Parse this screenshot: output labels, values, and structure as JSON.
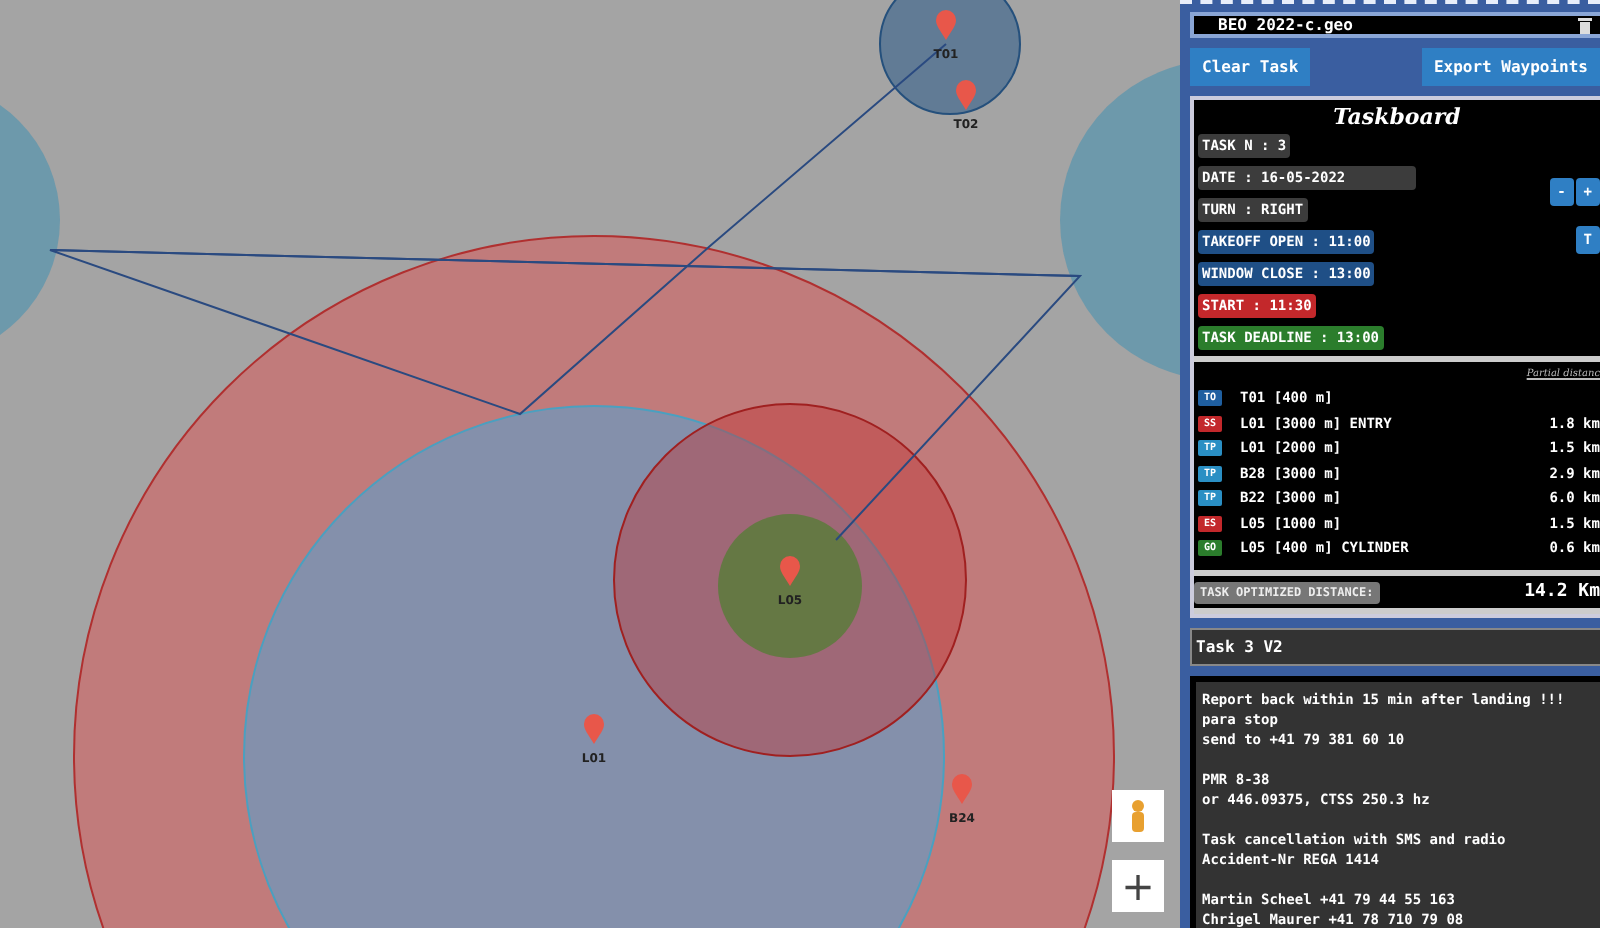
{
  "map": {
    "markers": [
      {
        "label": "T01"
      },
      {
        "label": "T02"
      },
      {
        "label": "L05"
      },
      {
        "label": "L01"
      },
      {
        "label": "B24"
      }
    ],
    "zoom_in": "+"
  },
  "panel": {
    "file": {
      "value": "BEO 2022-c.geo"
    },
    "buttons": [
      "Clear Task",
      "Export Waypoints"
    ],
    "taskboard": {
      "title": "Taskboard",
      "fields": [
        {
          "text": "TASK N : 3",
          "kind": "plain"
        },
        {
          "text": "DATE : 16-05-2022",
          "kind": "wide"
        },
        {
          "text": "TURN : RIGHT",
          "kind": "plain"
        },
        {
          "text": "TAKEOFF OPEN : 11:00",
          "kind": "blue"
        },
        {
          "text": "WINDOW CLOSE : 13:00",
          "kind": "blue"
        },
        {
          "text": "START : 11:30",
          "kind": "red"
        },
        {
          "text": "TASK DEADLINE : 13:00",
          "kind": "green"
        }
      ],
      "side_buttons": [
        "-",
        "+",
        "T"
      ],
      "distance_heading": "Partial distanc",
      "turnpoints": [
        {
          "type": "TO",
          "name": "T01 [400 m]"
        },
        {
          "type": "SS",
          "name": "L01 [3000 m] ENTRY",
          "distance": "1.8 km"
        },
        {
          "type": "TP",
          "name": "L01 [2000 m]",
          "distance": "1.5 km"
        },
        {
          "type": "TP",
          "name": "B28 [3000 m]",
          "distance": "2.9 km"
        },
        {
          "type": "TP",
          "name": "B22 [3000 m]",
          "distance": "6.0 km"
        },
        {
          "type": "ES",
          "name": "L05 [1000 m]",
          "distance": "1.5 km"
        },
        {
          "type": "GO",
          "name": "L05 [400 m] CYLINDER",
          "distance": "0.6 km"
        }
      ],
      "optimized_label": "TASK OPTIMIZED DISTANCE:",
      "optimized_value": "14.2 Km"
    },
    "title_note": "Task 3 V2",
    "notes": [
      [
        "Report back within 15 min after landing !!!",
        "para stop",
        "send to +41 79 381 60 10"
      ],
      [
        "PMR 8-38",
        "or 446.09375, CTSS 250.3 hz"
      ],
      [
        "Task cancellation with SMS and radio",
        "Accident-Nr REGA 1414"
      ],
      [
        "Martin Scheel +41 79 44 55 163",
        "Chrigel Maurer +41 78 710 79 08"
      ]
    ]
  }
}
